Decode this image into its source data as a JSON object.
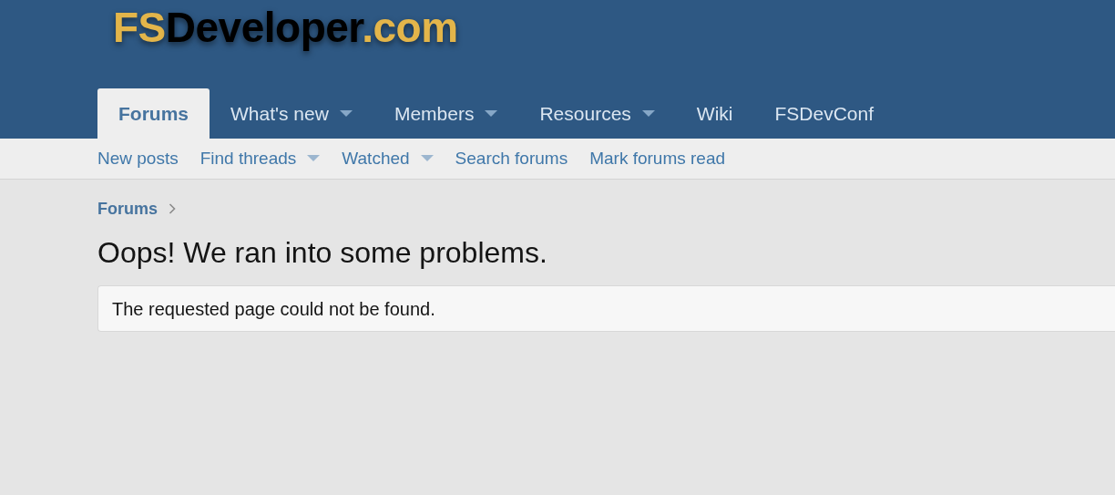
{
  "logo": [
    {
      "text": "FS",
      "color": "#e3b54a"
    },
    {
      "text": "Developer",
      "color": "#000000"
    },
    {
      "text": ".com",
      "color": "#e3b54a"
    }
  ],
  "nav_tabs": [
    {
      "label": "Forums",
      "selected": true,
      "dropdown": false
    },
    {
      "label": "What's new",
      "selected": false,
      "dropdown": true
    },
    {
      "label": "Members",
      "selected": false,
      "dropdown": true
    },
    {
      "label": "Resources",
      "selected": false,
      "dropdown": true
    },
    {
      "label": "Wiki",
      "selected": false,
      "dropdown": false
    },
    {
      "label": "FSDevConf",
      "selected": false,
      "dropdown": false
    }
  ],
  "sub_nav": [
    {
      "label": "New posts",
      "dropdown": false
    },
    {
      "label": "Find threads",
      "dropdown": true
    },
    {
      "label": "Watched",
      "dropdown": true
    },
    {
      "label": "Search forums",
      "dropdown": false
    },
    {
      "label": "Mark forums read",
      "dropdown": false
    }
  ],
  "breadcrumb": [
    "Forums"
  ],
  "page_title": "Oops! We ran into some problems.",
  "message": "The requested page could not be found."
}
